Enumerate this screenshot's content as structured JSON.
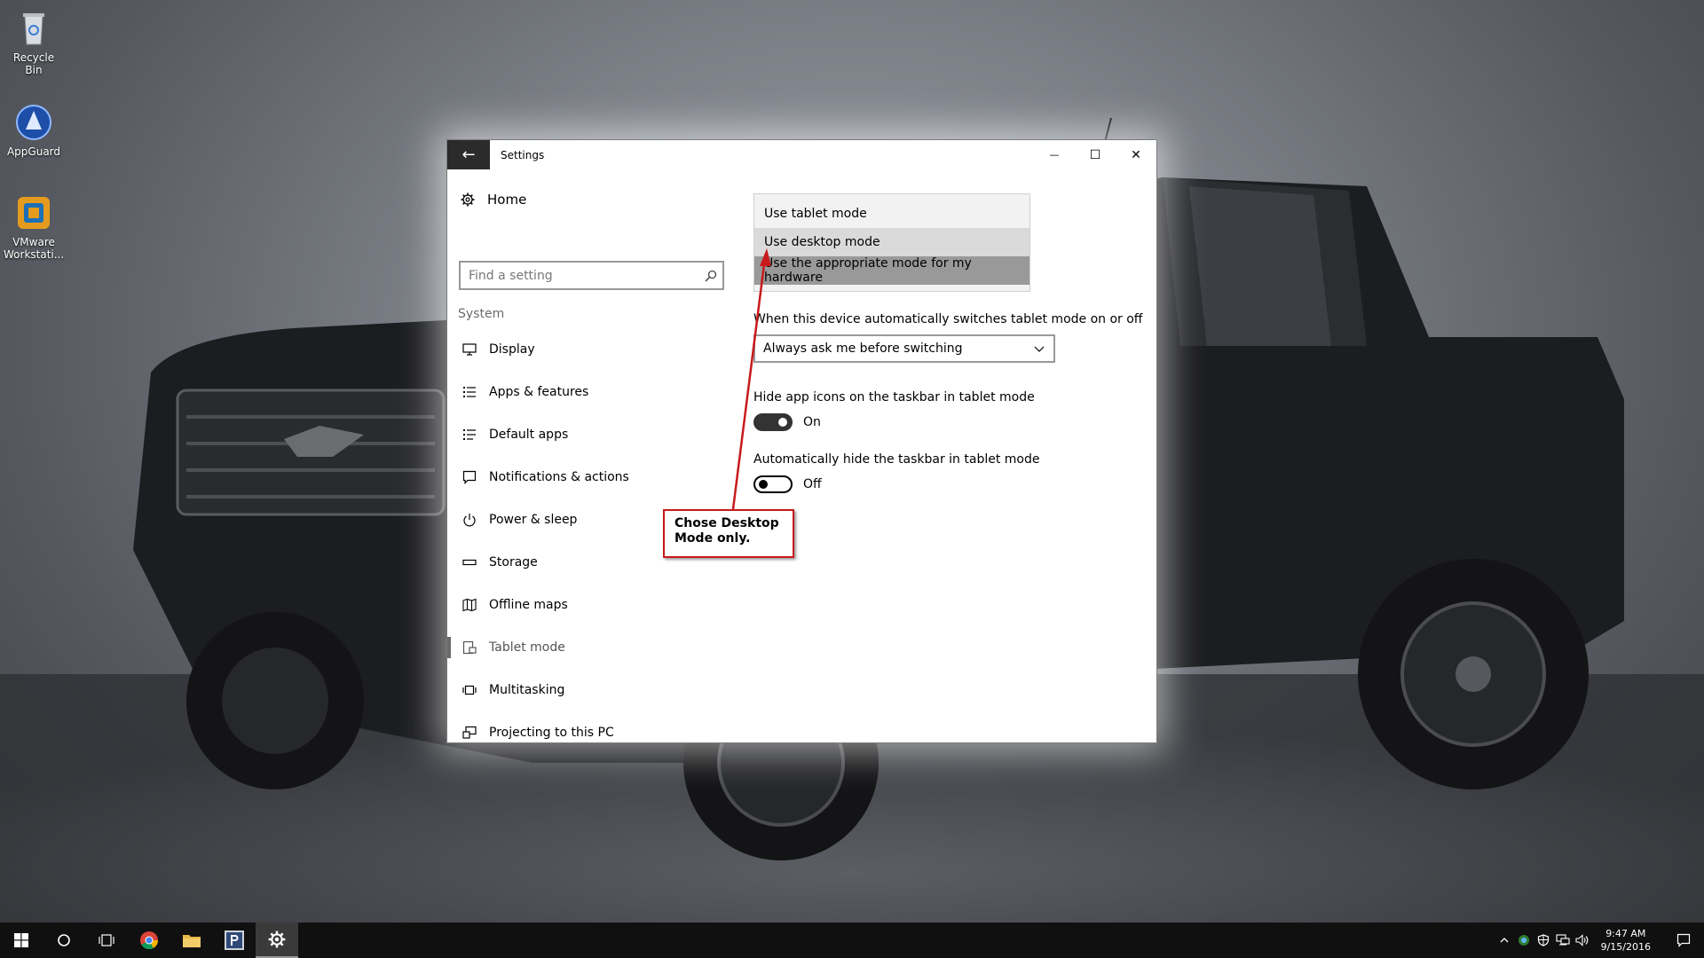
{
  "desktop": {
    "icons": [
      {
        "label": "Recycle Bin"
      },
      {
        "label": "AppGuard"
      },
      {
        "label": "VMware Workstati..."
      }
    ]
  },
  "window": {
    "title": "Settings",
    "back_symbol": "←",
    "minimize_symbol": "—",
    "maximize_symbol": "☐",
    "close_symbol": "✕"
  },
  "sidebar": {
    "home_label": "Home",
    "search_placeholder": "Find a setting",
    "section_label": "System",
    "items": [
      {
        "label": "Display",
        "icon": "display-icon"
      },
      {
        "label": "Apps & features",
        "icon": "apps-list-icon"
      },
      {
        "label": "Default apps",
        "icon": "default-apps-icon"
      },
      {
        "label": "Notifications & actions",
        "icon": "notification-icon"
      },
      {
        "label": "Power & sleep",
        "icon": "power-icon"
      },
      {
        "label": "Storage",
        "icon": "storage-icon"
      },
      {
        "label": "Offline maps",
        "icon": "map-icon"
      },
      {
        "label": "Tablet mode",
        "icon": "tablet-icon"
      },
      {
        "label": "Multitasking",
        "icon": "multitasking-icon"
      },
      {
        "label": "Projecting to this PC",
        "icon": "project-icon"
      }
    ],
    "active_item": "Tablet mode"
  },
  "content": {
    "signin_options": [
      "Use tablet mode",
      "Use desktop mode",
      "Use the appropriate mode for my hardware"
    ],
    "switch_label": "When this device automatically switches tablet mode on or off",
    "switch_value": "Always ask me before switching",
    "hide_icons_label": "Hide app icons on the taskbar in tablet mode",
    "hide_icons_state": "On",
    "hide_taskbar_label": "Automatically hide the taskbar in tablet mode",
    "hide_taskbar_state": "Off"
  },
  "annotation": {
    "line1": "Chose Desktop",
    "line2": "Mode only.",
    "color": "#c8191c"
  },
  "taskbar": {
    "time": "9:47 AM",
    "date": "9/15/2016"
  }
}
